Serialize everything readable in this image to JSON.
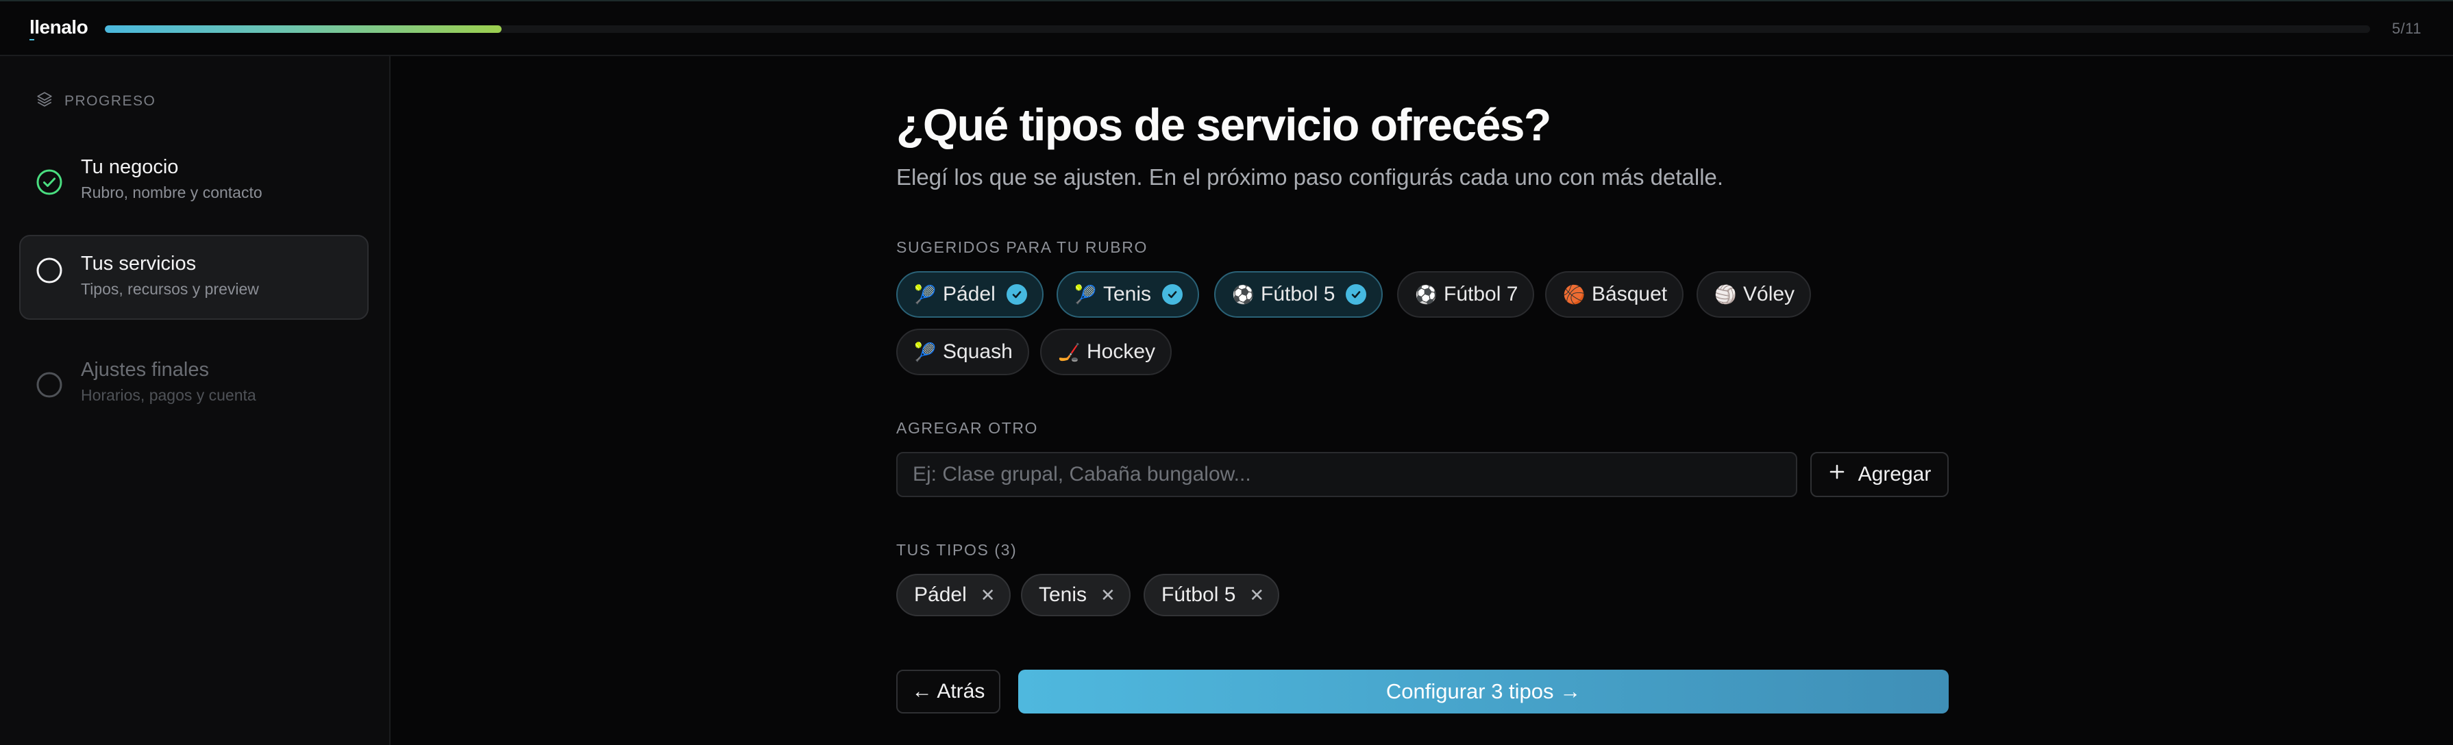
{
  "app": {
    "brand": "llenalo"
  },
  "progress": {
    "fraction": 0.175,
    "step_label": "5/11"
  },
  "sidebar": {
    "heading": "PROGRESO",
    "steps": [
      {
        "title": "Tu negocio",
        "subtitle": "Rubro, nombre y contacto",
        "state": "completed"
      },
      {
        "title": "Tus servicios",
        "subtitle": "Tipos, recursos y preview",
        "state": "active"
      },
      {
        "title": "Ajustes finales",
        "subtitle": "Horarios, pagos y cuenta",
        "state": "pending"
      }
    ]
  },
  "main": {
    "title": "¿Qué tipos de servicio ofrecés?",
    "subtitle": "Elegí los que se ajusten. En el próximo paso configurás cada uno con más detalle.",
    "suggested_label": "SUGERIDOS PARA TU RUBRO",
    "suggestions": [
      {
        "label": "Pádel",
        "emoji": "🎾",
        "selected": true
      },
      {
        "label": "Tenis",
        "emoji": "🎾",
        "selected": true
      },
      {
        "label": "Fútbol 5",
        "emoji": "⚽",
        "selected": true
      },
      {
        "label": "Fútbol 7",
        "emoji": "⚽",
        "selected": false
      },
      {
        "label": "Básquet",
        "emoji": "🏀",
        "selected": false
      },
      {
        "label": "Vóley",
        "emoji": "🏐",
        "selected": false
      },
      {
        "label": "Squash",
        "emoji": "🎾",
        "selected": false
      },
      {
        "label": "Hockey",
        "emoji": "🏒",
        "selected": false
      }
    ],
    "add_other_label": "AGREGAR OTRO",
    "add_input": {
      "value": "",
      "placeholder": "Ej: Clase grupal, Cabaña bungalow..."
    },
    "add_button_label": "Agregar",
    "your_types_label": "TUS TIPOS (3)",
    "your_types": [
      "Pádel",
      "Tenis",
      "Fútbol 5"
    ],
    "back_button_label": "← Atrás",
    "primary_button_label": "Configurar 3 tipos →"
  },
  "colors": {
    "accent": "#46b9e0",
    "progress_start": "#4bb8dd",
    "progress_end": "#9ccf4f",
    "completed": "#4ade80",
    "background": "#060607"
  }
}
